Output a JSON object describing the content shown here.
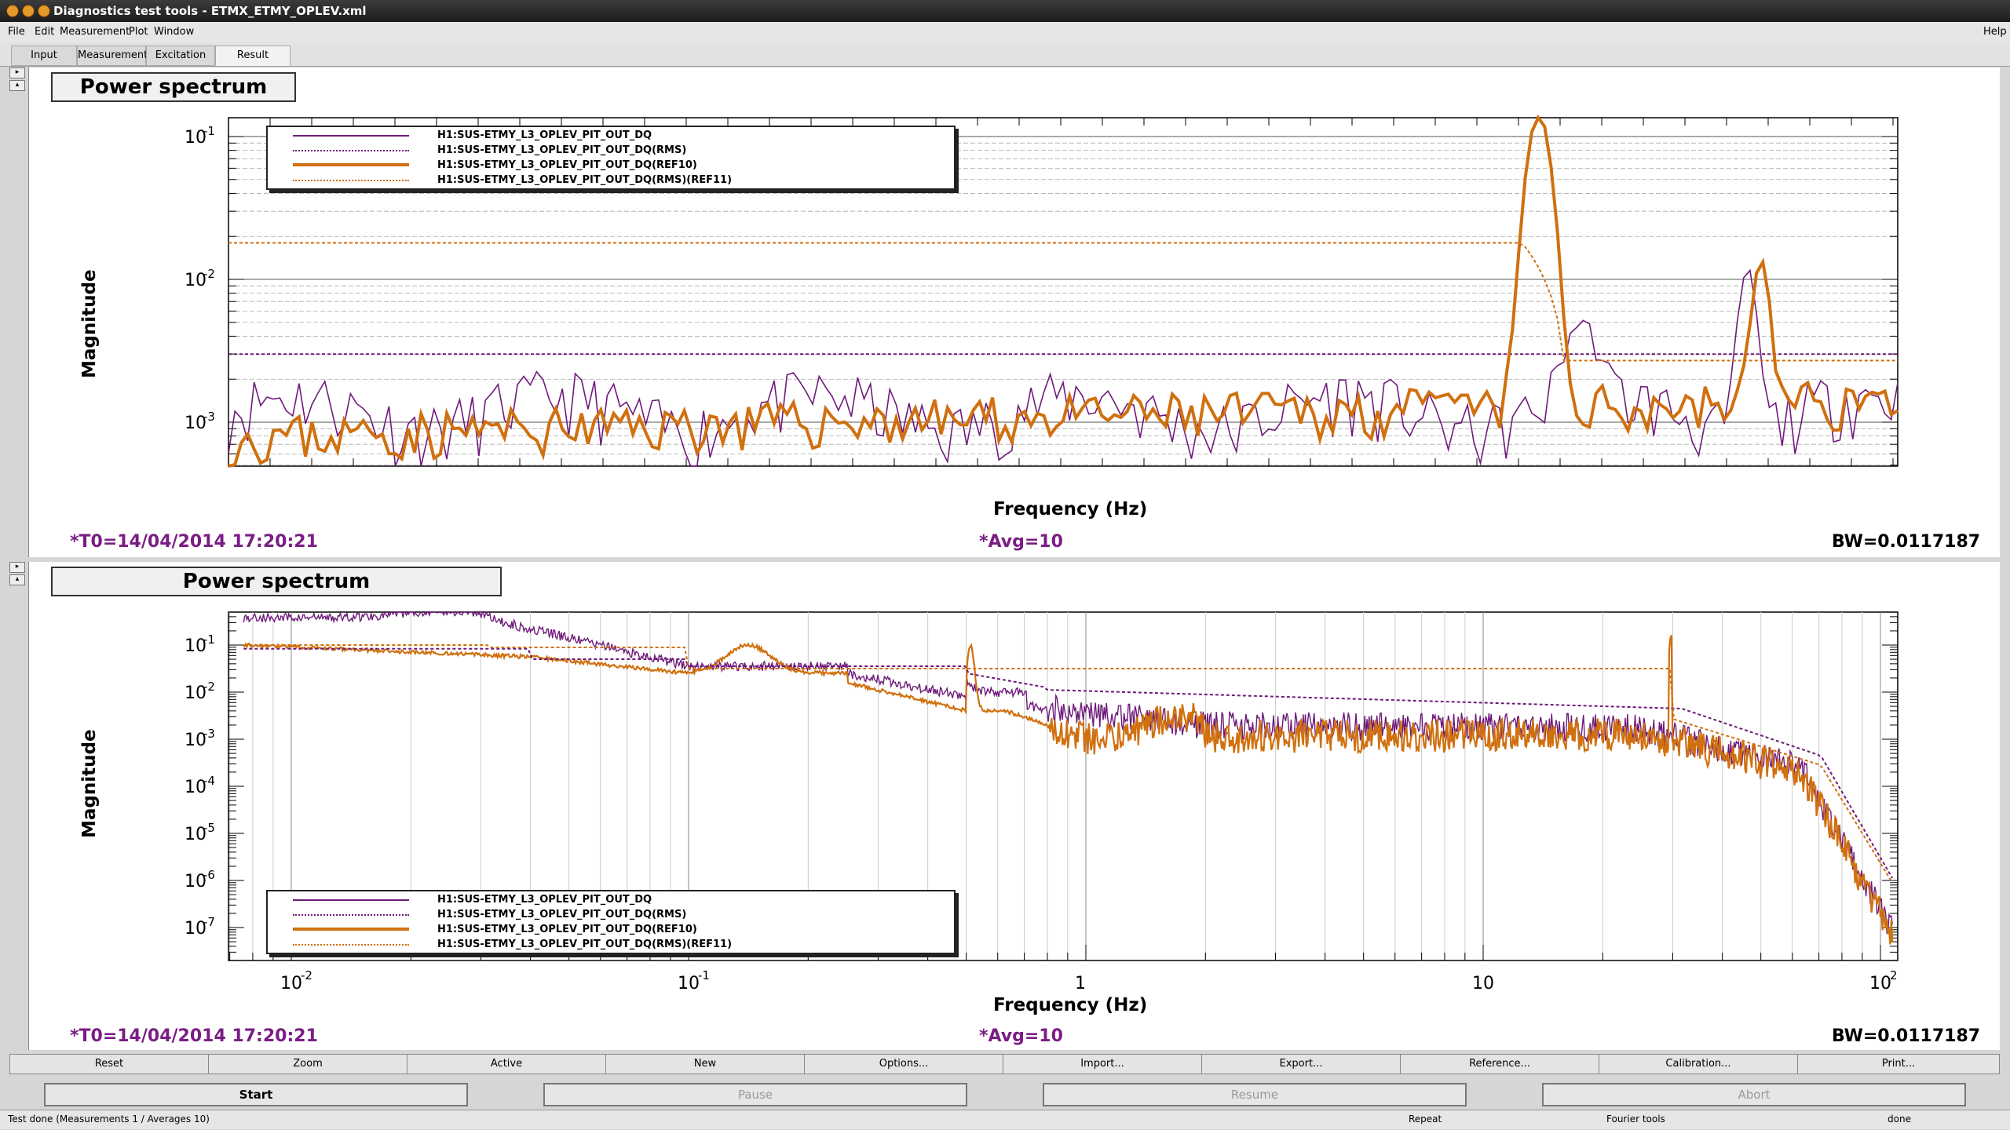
{
  "window": {
    "title": "Diagnostics test tools - ETMX_ETMY_OPLEV.xml"
  },
  "menu": [
    "File",
    "Edit",
    "Measurement",
    "Plot",
    "Window",
    "Help"
  ],
  "tabs": [
    "Input",
    "Measurement",
    "Excitation",
    "Result"
  ],
  "plots": [
    {
      "title": "Power spectrum",
      "xlabel": "Frequency (Hz)",
      "ylabel": "Magnitude",
      "t0": "*T0=14/04/2014 17:20:21",
      "avg": "*Avg=10",
      "bw": "BW=0.0117187",
      "yticks": [
        "10",
        "10",
        "10"
      ],
      "ytick_exps": [
        "-1",
        "-2",
        "-3"
      ],
      "legend": [
        "H1:SUS-ETMY_L3_OPLEV_PIT_OUT_DQ",
        "H1:SUS-ETMY_L3_OPLEV_PIT_OUT_DQ(RMS)",
        "H1:SUS-ETMY_L3_OPLEV_PIT_OUT_DQ(REF10)",
        "H1:SUS-ETMY_L3_OPLEV_PIT_OUT_DQ(RMS)(REF11)"
      ]
    },
    {
      "title": "Power spectrum",
      "xlabel": "Frequency (Hz)",
      "ylabel": "Magnitude",
      "t0": "*T0=14/04/2014 17:20:21",
      "avg": "*Avg=10",
      "bw": "BW=0.0117187",
      "xticks": [
        "10",
        "10",
        "1",
        "10",
        "10"
      ],
      "xtick_exps": [
        "-2",
        "-1",
        "",
        "",
        "2"
      ],
      "yticks": [
        "10",
        "10",
        "10",
        "10",
        "10",
        "10",
        "10"
      ],
      "ytick_exps": [
        "-1",
        "-2",
        "-3",
        "-4",
        "-5",
        "-6",
        "-7"
      ],
      "legend": [
        "H1:SUS-ETMY_L3_OPLEV_PIT_OUT_DQ",
        "H1:SUS-ETMY_L3_OPLEV_PIT_OUT_DQ(RMS)",
        "H1:SUS-ETMY_L3_OPLEV_PIT_OUT_DQ(REF10)",
        "H1:SUS-ETMY_L3_OPLEV_PIT_OUT_DQ(RMS)(REF11)"
      ]
    }
  ],
  "colors": {
    "purple": "#6e1a7a",
    "orange": "#d0700f"
  },
  "toolbar": [
    "Reset",
    "Zoom",
    "Active",
    "New",
    "Options...",
    "Import...",
    "Export...",
    "Reference...",
    "Calibration...",
    "Print..."
  ],
  "controls": [
    "Start",
    "Pause",
    "Resume",
    "Abort"
  ],
  "status": {
    "message": "Test done (Measurements 1 / Averages 10)",
    "repeat": "Repeat",
    "fourier": "Fourier tools",
    "state": "done"
  }
}
